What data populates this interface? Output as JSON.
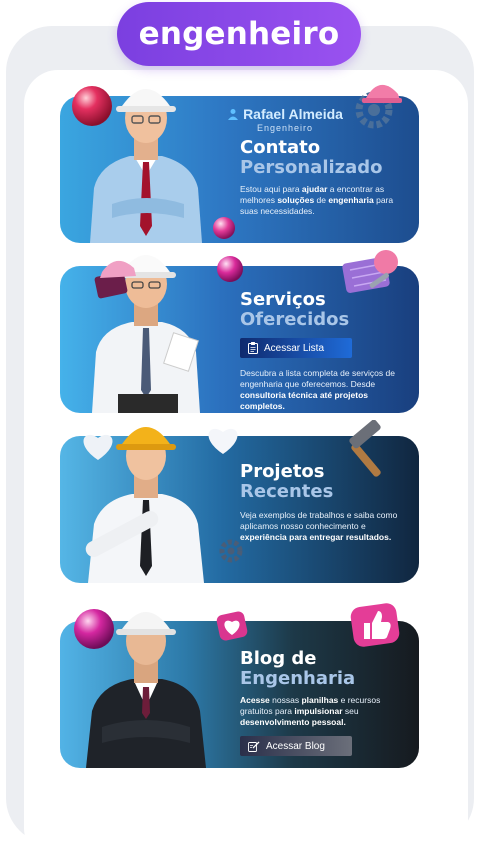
{
  "header": {
    "title": "engenheiro"
  },
  "cards": [
    {
      "brand_name": "Rafael Almeida",
      "brand_role": "Engenheiro",
      "title_line1": "Contato",
      "title_line2": "Personalizado",
      "body_parts": [
        "Estou aqui para ",
        "ajudar",
        " a encontrar as melhores ",
        "soluções",
        " de ",
        "engenharia",
        " para suas necessidades."
      ]
    },
    {
      "title_line1": "Serviços",
      "title_line2": "Oferecidos",
      "button_label": "Acessar Lista",
      "body_parts": [
        "Descubra a lista completa de serviços de engenharia que oferecemos. Desde ",
        "consultoria técnica até projetos completos."
      ]
    },
    {
      "title_line1": "Projetos",
      "title_line2": "Recentes",
      "body_parts": [
        "Veja exemplos de trabalhos e saiba como aplicamos nosso conhecimento e ",
        "experiência para entregar resultados."
      ]
    },
    {
      "title_line1": "Blog de",
      "title_line2": "Engenharia",
      "button_label": "Acessar Blog",
      "body_parts": [
        "Acesse",
        " nossas ",
        "planilhas",
        " e recursos gratuitos para ",
        "impulsionar",
        " seu ",
        "desenvolvimento pessoal."
      ]
    }
  ],
  "colors": {
    "accent": "#8a48ea",
    "pill_text": "#ffffff"
  },
  "icons": [
    "hard-hat-icon",
    "gear-icon",
    "blueprint-icon",
    "hammer-icon",
    "heart-icon",
    "thumbs-up-icon",
    "clipboard-icon",
    "edit-icon",
    "person-icon"
  ]
}
